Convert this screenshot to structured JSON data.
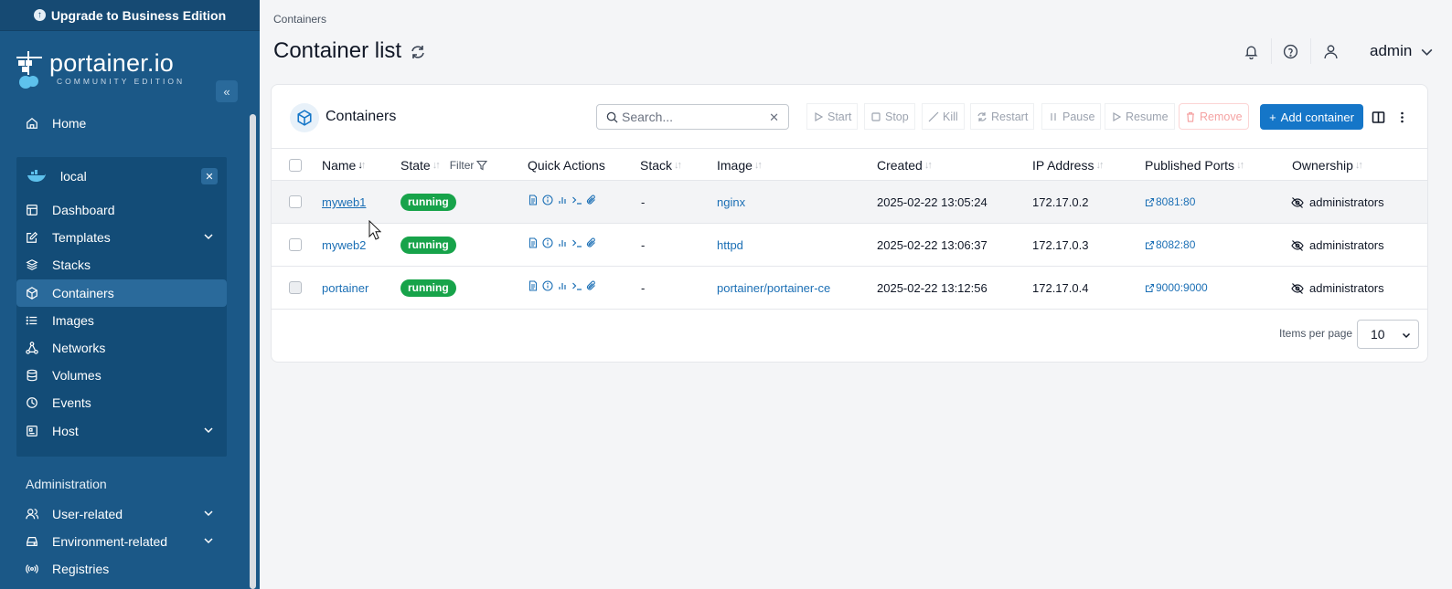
{
  "sidebar": {
    "upgrade_label": "Upgrade to Business Edition",
    "logo_text": "portainer.io",
    "logo_subtitle": "COMMUNITY EDITION",
    "home_label": "Home",
    "environment": {
      "name": "local",
      "items": [
        {
          "label": "Dashboard",
          "icon": "dashboard-icon"
        },
        {
          "label": "Templates",
          "icon": "edit-icon",
          "expandable": true
        },
        {
          "label": "Stacks",
          "icon": "layers-icon"
        },
        {
          "label": "Containers",
          "icon": "cube-icon",
          "active": true
        },
        {
          "label": "Images",
          "icon": "list-icon"
        },
        {
          "label": "Networks",
          "icon": "network-icon"
        },
        {
          "label": "Volumes",
          "icon": "database-icon"
        },
        {
          "label": "Events",
          "icon": "clock-icon"
        },
        {
          "label": "Host",
          "icon": "host-icon",
          "expandable": true
        }
      ]
    },
    "admin_title": "Administration",
    "admin_items": [
      {
        "label": "User-related",
        "icon": "user-icon",
        "expandable": true
      },
      {
        "label": "Environment-related",
        "icon": "drive-icon",
        "expandable": true
      },
      {
        "label": "Registries",
        "icon": "radio-icon"
      }
    ]
  },
  "header": {
    "breadcrumb": "Containers",
    "title": "Container list",
    "user": "admin"
  },
  "card": {
    "title": "Containers",
    "search_placeholder": "Search...",
    "actions": {
      "start": "Start",
      "stop": "Stop",
      "kill": "Kill",
      "restart": "Restart",
      "pause": "Pause",
      "resume": "Resume",
      "remove": "Remove"
    },
    "add_label": "Add container",
    "columns": {
      "name": "Name",
      "state": "State",
      "filter": "Filter",
      "quick_actions": "Quick Actions",
      "stack": "Stack",
      "image": "Image",
      "created": "Created",
      "ip": "IP Address",
      "ports": "Published Ports",
      "ownership": "Ownership"
    },
    "rows": [
      {
        "name": "myweb1",
        "state": "running",
        "stack": "-",
        "image": "nginx",
        "created": "2025-02-22 13:05:24",
        "ip": "172.17.0.2",
        "port": "8081:80",
        "ownership": "administrators"
      },
      {
        "name": "myweb2",
        "state": "running",
        "stack": "-",
        "image": "httpd",
        "created": "2025-02-22 13:06:37",
        "ip": "172.17.0.3",
        "port": "8082:80",
        "ownership": "administrators"
      },
      {
        "name": "portainer",
        "state": "running",
        "stack": "-",
        "image": "portainer/portainer-ce",
        "created": "2025-02-22 13:12:56",
        "ip": "172.17.0.4",
        "port": "9000:9000",
        "ownership": "administrators"
      }
    ],
    "items_per_page_label": "Items per page",
    "items_per_page_value": "10"
  },
  "colors": {
    "sidebar_bg": "#1b5887",
    "primary": "#1576c8",
    "running": "#17a34a",
    "link": "#1b6fb5"
  }
}
